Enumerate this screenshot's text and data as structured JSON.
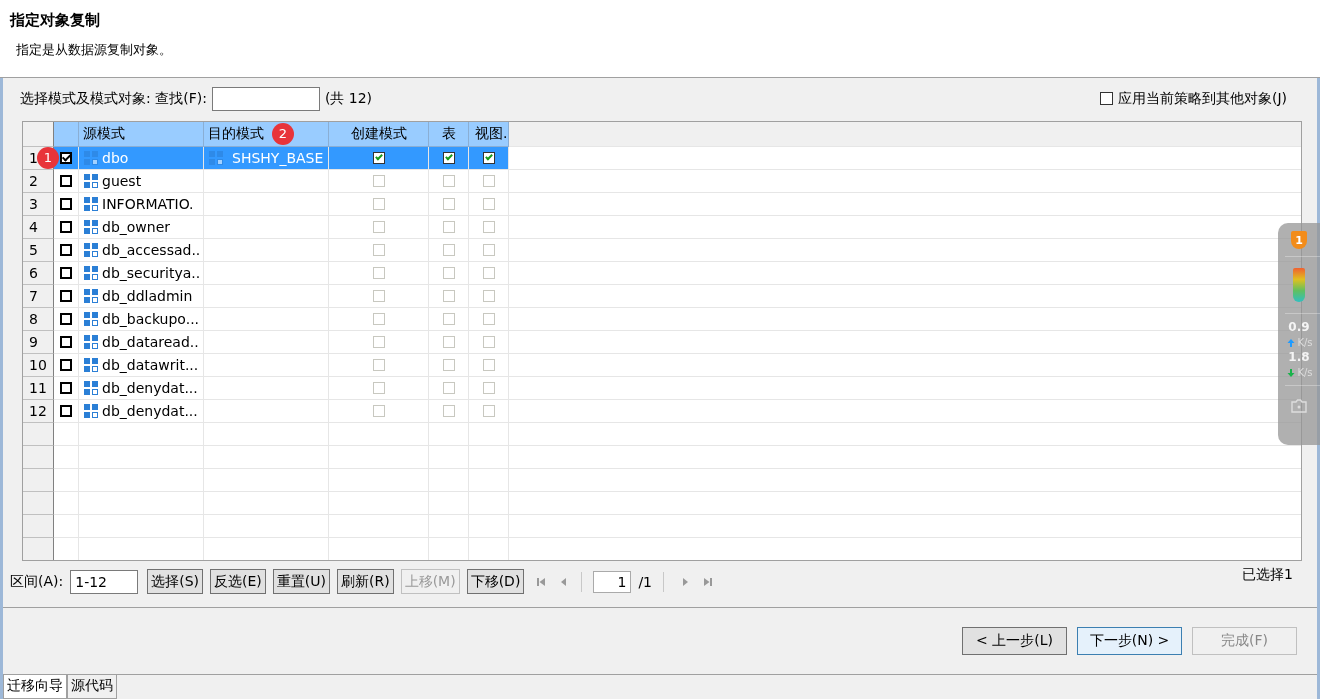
{
  "header": {
    "title": "指定对象复制",
    "subtitle": "指定是从数据源复制对象。"
  },
  "filter": {
    "label": "选择模式及模式对象: 查找(F):",
    "count": "(共 12)",
    "apply_label": "应用当前策略到其他对象(J)",
    "apply_checked": false
  },
  "table": {
    "columns": [
      "源模式",
      "目的模式",
      "创建模式",
      "表",
      "视图."
    ],
    "rows": [
      {
        "num": "1",
        "selected": true,
        "checked": true,
        "source": "dbo",
        "target": "SHSHY_BASE",
        "create": true,
        "table": true,
        "view": true,
        "disabled": false
      },
      {
        "num": "2",
        "selected": false,
        "checked": false,
        "source": "guest",
        "create": false,
        "table": false,
        "view": false,
        "disabled": true
      },
      {
        "num": "3",
        "selected": false,
        "checked": false,
        "source": "INFORMATIO.",
        "create": false,
        "table": false,
        "view": false,
        "disabled": true
      },
      {
        "num": "4",
        "selected": false,
        "checked": false,
        "source": "db_owner",
        "create": false,
        "table": false,
        "view": false,
        "disabled": true
      },
      {
        "num": "5",
        "selected": false,
        "checked": false,
        "source": "db_accessad..",
        "create": false,
        "table": false,
        "view": false,
        "disabled": true
      },
      {
        "num": "6",
        "selected": false,
        "checked": false,
        "source": "db_securitya..",
        "create": false,
        "table": false,
        "view": false,
        "disabled": true
      },
      {
        "num": "7",
        "selected": false,
        "checked": false,
        "source": "db_ddladmin",
        "create": false,
        "table": false,
        "view": false,
        "disabled": true
      },
      {
        "num": "8",
        "selected": false,
        "checked": false,
        "source": "db_backupo...",
        "create": false,
        "table": false,
        "view": false,
        "disabled": true
      },
      {
        "num": "9",
        "selected": false,
        "checked": false,
        "source": "db_dataread..",
        "create": false,
        "table": false,
        "view": false,
        "disabled": true
      },
      {
        "num": "10",
        "selected": false,
        "checked": false,
        "source": "db_datawrit...",
        "create": false,
        "table": false,
        "view": false,
        "disabled": true
      },
      {
        "num": "11",
        "selected": false,
        "checked": false,
        "source": "db_denydat...",
        "create": false,
        "table": false,
        "view": false,
        "disabled": true
      },
      {
        "num": "12",
        "selected": false,
        "checked": false,
        "source": "db_denydat...",
        "create": false,
        "table": false,
        "view": false,
        "disabled": true
      }
    ]
  },
  "badges": [
    "1",
    "2"
  ],
  "toolbar": {
    "range_label": "区间(A):",
    "range_value": "1-12",
    "buttons": [
      {
        "label": "选择(S)",
        "disabled": false
      },
      {
        "label": "反选(E)",
        "disabled": false
      },
      {
        "label": "重置(U)",
        "disabled": false
      },
      {
        "label": "刷新(R)",
        "disabled": false
      },
      {
        "label": "上移(M)",
        "disabled": true
      },
      {
        "label": "下移(D)",
        "disabled": false
      }
    ],
    "page": "1",
    "pages": "/1",
    "selected_count": "已选择1"
  },
  "nav_buttons": [
    {
      "label": "< 上一步(L)",
      "disabled": false,
      "focused": false
    },
    {
      "label": "下一步(N) >",
      "disabled": false,
      "focused": true
    },
    {
      "label": "完成(F)",
      "disabled": true,
      "focused": false
    }
  ],
  "bottom_tabs": [
    {
      "label": "迁移向导",
      "selected": true
    },
    {
      "label": "源代码",
      "selected": false
    }
  ],
  "widget": {
    "shield_count": "1",
    "upload": "0.9",
    "upload_unit": "K/s",
    "download": "1.8",
    "download_unit": "K/s"
  }
}
